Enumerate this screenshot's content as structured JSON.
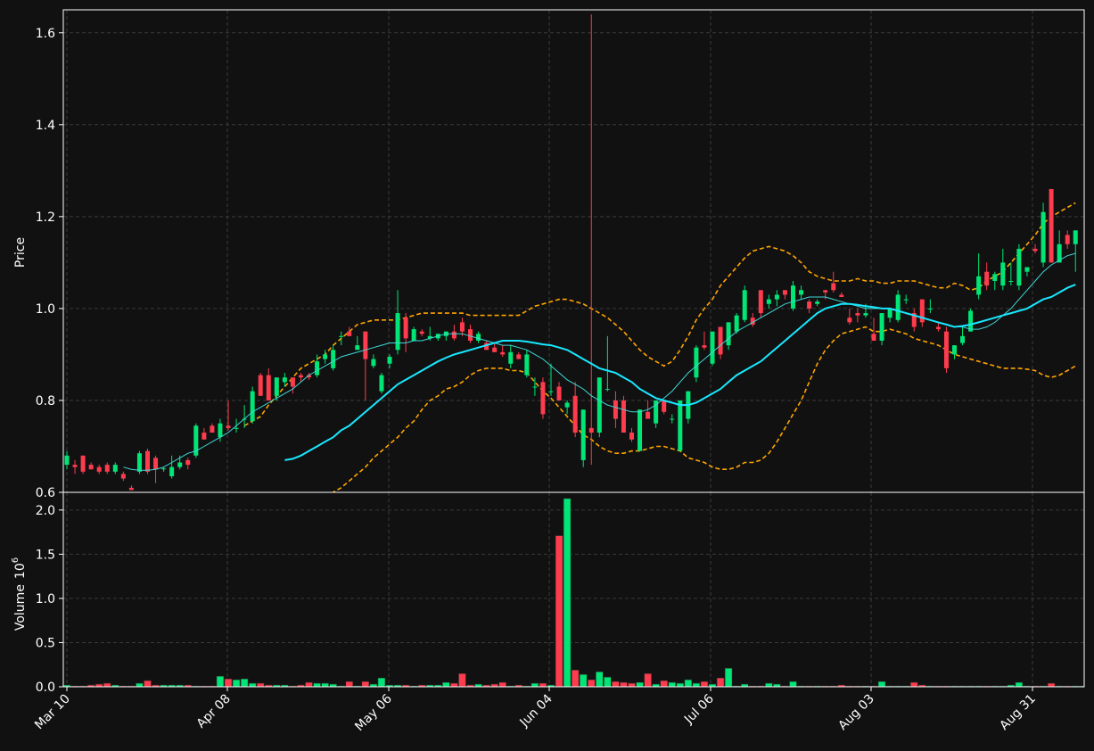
{
  "chart_data": [
    {
      "type": "candlestick",
      "ylabel": "Price",
      "ylim": [
        0.6,
        1.65
      ],
      "yticks": [
        "0.6",
        "0.8",
        "1.0",
        "1.2",
        "1.4",
        "1.6"
      ],
      "xtick_labels": [
        "Mar 10",
        "Apr 08",
        "May 06",
        "Jun 04",
        "Jul 06",
        "Aug 03",
        "Aug 31"
      ],
      "overlays": [
        "moving-average-fast",
        "moving-average-slow",
        "bollinger-upper",
        "bollinger-lower"
      ],
      "grid": true,
      "colors": {
        "up": "#00e676",
        "down": "#ff3b4e",
        "ma_fast": "#40d8d8",
        "ma_slow": "#18e8ff",
        "bands": "#ffa500",
        "background": "#111111",
        "grid": "#3a3a3a",
        "text": "#ffffff"
      },
      "ohlc": [
        [
          0.66,
          0.69,
          0.65,
          0.68
        ],
        [
          0.66,
          0.67,
          0.64,
          0.655
        ],
        [
          0.68,
          0.68,
          0.64,
          0.645
        ],
        [
          0.66,
          0.665,
          0.65,
          0.65
        ],
        [
          0.655,
          0.66,
          0.64,
          0.645
        ],
        [
          0.66,
          0.665,
          0.64,
          0.645
        ],
        [
          0.645,
          0.665,
          0.64,
          0.66
        ],
        [
          0.64,
          0.645,
          0.625,
          0.63
        ],
        [
          0.61,
          0.615,
          0.605,
          0.605
        ],
        [
          0.645,
          0.69,
          0.64,
          0.685
        ],
        [
          0.69,
          0.695,
          0.64,
          0.645
        ],
        [
          0.675,
          0.68,
          0.62,
          0.65
        ],
        [
          0.65,
          0.655,
          0.645,
          0.652
        ],
        [
          0.635,
          0.68,
          0.63,
          0.655
        ],
        [
          0.655,
          0.68,
          0.65,
          0.665
        ],
        [
          0.67,
          0.675,
          0.65,
          0.66
        ],
        [
          0.68,
          0.75,
          0.675,
          0.745
        ],
        [
          0.73,
          0.74,
          0.715,
          0.715
        ],
        [
          0.745,
          0.75,
          0.735,
          0.73
        ],
        [
          0.72,
          0.76,
          0.71,
          0.75
        ],
        [
          0.745,
          0.8,
          0.735,
          0.74
        ],
        [
          0.74,
          0.76,
          0.73,
          0.74
        ],
        [
          0.76,
          0.79,
          0.74,
          0.76
        ],
        [
          0.755,
          0.83,
          0.75,
          0.82
        ],
        [
          0.855,
          0.86,
          0.81,
          0.81
        ],
        [
          0.855,
          0.87,
          0.8,
          0.8
        ],
        [
          0.81,
          0.85,
          0.8,
          0.85
        ],
        [
          0.84,
          0.86,
          0.83,
          0.85
        ],
        [
          0.85,
          0.85,
          0.815,
          0.83
        ],
        [
          0.855,
          0.86,
          0.84,
          0.85
        ],
        [
          0.855,
          0.86,
          0.845,
          0.85
        ],
        [
          0.855,
          0.9,
          0.85,
          0.885
        ],
        [
          0.89,
          0.91,
          0.88,
          0.9
        ],
        [
          0.87,
          0.92,
          0.865,
          0.91
        ],
        [
          0.94,
          0.95,
          0.92,
          0.94
        ],
        [
          0.95,
          0.96,
          0.94,
          0.94
        ],
        [
          0.91,
          0.94,
          0.91,
          0.92
        ],
        [
          0.95,
          0.95,
          0.8,
          0.89
        ],
        [
          0.875,
          0.9,
          0.87,
          0.89
        ],
        [
          0.82,
          0.86,
          0.815,
          0.855
        ],
        [
          0.88,
          0.9,
          0.87,
          0.895
        ],
        [
          0.91,
          1.04,
          0.9,
          0.99
        ],
        [
          0.98,
          0.99,
          0.905,
          0.935
        ],
        [
          0.93,
          0.96,
          0.93,
          0.955
        ],
        [
          0.95,
          0.955,
          0.94,
          0.945
        ],
        [
          0.935,
          0.96,
          0.93,
          0.94
        ],
        [
          0.935,
          0.945,
          0.93,
          0.945
        ],
        [
          0.94,
          0.95,
          0.93,
          0.95
        ],
        [
          0.95,
          0.965,
          0.93,
          0.935
        ],
        [
          0.97,
          0.98,
          0.94,
          0.95
        ],
        [
          0.955,
          0.965,
          0.925,
          0.93
        ],
        [
          0.93,
          0.95,
          0.925,
          0.945
        ],
        [
          0.925,
          0.93,
          0.91,
          0.91
        ],
        [
          0.915,
          0.925,
          0.905,
          0.905
        ],
        [
          0.905,
          0.92,
          0.895,
          0.9
        ],
        [
          0.88,
          0.92,
          0.87,
          0.905
        ],
        [
          0.9,
          0.905,
          0.89,
          0.89
        ],
        [
          0.855,
          0.91,
          0.85,
          0.9
        ],
        [
          0.83,
          0.85,
          0.81,
          0.83
        ],
        [
          0.84,
          0.85,
          0.76,
          0.77
        ],
        [
          0.82,
          0.88,
          0.81,
          0.82
        ],
        [
          0.83,
          0.84,
          0.8,
          0.8
        ],
        [
          0.785,
          0.8,
          0.77,
          0.795
        ],
        [
          0.81,
          0.84,
          0.72,
          0.73
        ],
        [
          0.67,
          0.78,
          0.655,
          0.78
        ],
        [
          0.74,
          1.64,
          0.66,
          0.73
        ],
        [
          0.73,
          0.82,
          0.72,
          0.85
        ],
        [
          0.825,
          0.94,
          0.82,
          0.825
        ],
        [
          0.8,
          0.82,
          0.74,
          0.76
        ],
        [
          0.8,
          0.81,
          0.73,
          0.73
        ],
        [
          0.73,
          0.74,
          0.71,
          0.715
        ],
        [
          0.69,
          0.78,
          0.69,
          0.78
        ],
        [
          0.775,
          0.8,
          0.76,
          0.76
        ],
        [
          0.75,
          0.8,
          0.74,
          0.8
        ],
        [
          0.8,
          0.8,
          0.77,
          0.775
        ],
        [
          0.76,
          0.77,
          0.75,
          0.76
        ],
        [
          0.69,
          0.8,
          0.69,
          0.8
        ],
        [
          0.76,
          0.82,
          0.75,
          0.82
        ],
        [
          0.85,
          0.92,
          0.84,
          0.915
        ],
        [
          0.92,
          0.95,
          0.91,
          0.915
        ],
        [
          0.88,
          0.94,
          0.875,
          0.95
        ],
        [
          0.96,
          0.96,
          0.89,
          0.9
        ],
        [
          0.92,
          0.97,
          0.91,
          0.97
        ],
        [
          0.95,
          0.99,
          0.945,
          0.985
        ],
        [
          0.975,
          1.05,
          0.97,
          1.04
        ],
        [
          0.98,
          0.99,
          0.96,
          0.965
        ],
        [
          1.04,
          1.04,
          0.98,
          0.99
        ],
        [
          1.01,
          1.03,
          1.0,
          1.02
        ],
        [
          1.02,
          1.04,
          1.005,
          1.03
        ],
        [
          1.04,
          1.04,
          1.02,
          1.03
        ],
        [
          1.0,
          1.06,
          0.995,
          1.05
        ],
        [
          1.03,
          1.05,
          1.02,
          1.04
        ],
        [
          1.015,
          1.02,
          0.99,
          1.0
        ],
        [
          1.01,
          1.02,
          1.005,
          1.015
        ],
        [
          1.04,
          1.04,
          1.02,
          1.035
        ],
        [
          1.055,
          1.08,
          1.035,
          1.04
        ],
        [
          1.03,
          1.035,
          1.025,
          1.025
        ],
        [
          0.98,
          1.0,
          0.965,
          0.97
        ],
        [
          0.99,
          1.0,
          0.97,
          0.985
        ],
        [
          0.985,
          1.01,
          0.98,
          0.99
        ],
        [
          0.945,
          0.98,
          0.93,
          0.93
        ],
        [
          0.93,
          0.98,
          0.92,
          0.99
        ],
        [
          0.98,
          1.0,
          0.97,
          1.0
        ],
        [
          0.975,
          1.04,
          0.97,
          1.03
        ],
        [
          1.02,
          1.03,
          1.01,
          1.02
        ],
        [
          0.99,
          1.0,
          0.95,
          0.96
        ],
        [
          1.02,
          1.02,
          0.96,
          0.97
        ],
        [
          1.0,
          1.02,
          0.99,
          1.0
        ],
        [
          0.96,
          0.97,
          0.95,
          0.955
        ],
        [
          0.95,
          0.96,
          0.86,
          0.87
        ],
        [
          0.9,
          0.92,
          0.89,
          0.92
        ],
        [
          0.925,
          0.96,
          0.92,
          0.94
        ],
        [
          0.95,
          1.0,
          0.95,
          0.995
        ],
        [
          1.03,
          1.12,
          1.02,
          1.07
        ],
        [
          1.08,
          1.1,
          1.04,
          1.05
        ],
        [
          1.06,
          1.08,
          1.04,
          1.075
        ],
        [
          1.05,
          1.13,
          1.04,
          1.1
        ],
        [
          1.06,
          1.1,
          1.05,
          1.06
        ],
        [
          1.05,
          1.14,
          1.04,
          1.13
        ],
        [
          1.08,
          1.09,
          1.07,
          1.09
        ],
        [
          1.13,
          1.14,
          1.12,
          1.125
        ],
        [
          1.1,
          1.23,
          1.09,
          1.21
        ],
        [
          1.26,
          1.26,
          1.1,
          1.1
        ],
        [
          1.1,
          1.17,
          1.1,
          1.14
        ],
        [
          1.16,
          1.17,
          1.13,
          1.14
        ],
        [
          1.14,
          1.17,
          1.08,
          1.17
        ]
      ],
      "ma_fast": [
        0.655,
        0.65,
        0.648,
        0.648,
        0.65,
        0.655,
        0.665,
        0.675,
        0.685,
        0.69,
        0.7,
        0.71,
        0.72,
        0.73,
        0.745,
        0.76,
        0.775,
        0.785,
        0.795,
        0.805,
        0.815,
        0.825,
        0.84,
        0.855,
        0.865,
        0.875,
        0.885,
        0.895,
        0.9,
        0.905,
        0.91,
        0.915,
        0.92,
        0.925,
        0.925,
        0.925,
        0.93,
        0.93,
        0.935,
        0.94,
        0.945,
        0.945,
        0.945,
        0.94,
        0.935,
        0.93,
        0.925,
        0.92,
        0.92,
        0.915,
        0.91,
        0.9,
        0.89,
        0.875,
        0.86,
        0.845,
        0.835,
        0.825,
        0.81,
        0.8,
        0.79,
        0.785,
        0.78,
        0.775,
        0.775,
        0.78,
        0.79,
        0.805,
        0.82,
        0.84,
        0.86,
        0.875,
        0.89,
        0.905,
        0.92,
        0.935,
        0.95,
        0.96,
        0.97,
        0.98,
        0.99,
        1.0,
        1.01,
        1.015,
        1.02,
        1.025,
        1.025,
        1.025,
        1.02,
        1.015,
        1.01,
        1.005,
        1.0,
        1.0,
        1.0,
        1.0,
        0.995,
        0.99,
        0.985,
        0.98,
        0.975,
        0.97,
        0.965,
        0.96,
        0.96,
        0.955,
        0.955,
        0.96,
        0.97,
        0.985,
        1.0,
        1.02,
        1.04,
        1.06,
        1.08,
        1.095,
        1.105,
        1.115,
        1.12
      ],
      "ma_slow": [
        0.67,
        0.673,
        0.68,
        0.69,
        0.7,
        0.71,
        0.72,
        0.735,
        0.745,
        0.76,
        0.775,
        0.79,
        0.805,
        0.82,
        0.835,
        0.845,
        0.855,
        0.865,
        0.875,
        0.885,
        0.893,
        0.9,
        0.905,
        0.91,
        0.915,
        0.92,
        0.925,
        0.93,
        0.93,
        0.93,
        0.928,
        0.925,
        0.922,
        0.92,
        0.915,
        0.91,
        0.9,
        0.89,
        0.88,
        0.87,
        0.865,
        0.86,
        0.85,
        0.84,
        0.825,
        0.815,
        0.805,
        0.8,
        0.795,
        0.79,
        0.79,
        0.795,
        0.805,
        0.815,
        0.825,
        0.84,
        0.855,
        0.865,
        0.875,
        0.885,
        0.9,
        0.915,
        0.93,
        0.945,
        0.96,
        0.975,
        0.99,
        1.0,
        1.005,
        1.01,
        1.01,
        1.008,
        1.005,
        1.003,
        1.0,
        1.0,
        0.995,
        0.99,
        0.985,
        0.98,
        0.975,
        0.97,
        0.965,
        0.96,
        0.962,
        0.965,
        0.97,
        0.975,
        0.98,
        0.985,
        0.99,
        0.995,
        1.0,
        1.01,
        1.02,
        1.025,
        1.035,
        1.045,
        1.052
      ],
      "band_upper": [
        0.745,
        0.755,
        0.765,
        0.79,
        0.81,
        0.83,
        0.85,
        0.87,
        0.88,
        0.89,
        0.9,
        0.92,
        0.935,
        0.95,
        0.965,
        0.97,
        0.975,
        0.975,
        0.975,
        0.975,
        0.98,
        0.985,
        0.99,
        0.99,
        0.99,
        0.99,
        0.99,
        0.99,
        0.985,
        0.985,
        0.985,
        0.985,
        0.985,
        0.985,
        0.985,
        0.995,
        1.005,
        1.01,
        1.015,
        1.02,
        1.02,
        1.015,
        1.01,
        1.0,
        0.99,
        0.98,
        0.965,
        0.95,
        0.93,
        0.91,
        0.895,
        0.885,
        0.875,
        0.885,
        0.91,
        0.94,
        0.975,
        1.0,
        1.02,
        1.05,
        1.07,
        1.09,
        1.11,
        1.125,
        1.13,
        1.135,
        1.13,
        1.125,
        1.115,
        1.1,
        1.08,
        1.07,
        1.065,
        1.06,
        1.06,
        1.06,
        1.065,
        1.06,
        1.06,
        1.055,
        1.055,
        1.06,
        1.06,
        1.06,
        1.055,
        1.05,
        1.045,
        1.045,
        1.055,
        1.05,
        1.04,
        1.045,
        1.06,
        1.07,
        1.08,
        1.1,
        1.12,
        1.14,
        1.16,
        1.185,
        1.2,
        1.21,
        1.22,
        1.23
      ],
      "band_lower": [
        0.59,
        0.6,
        0.61,
        0.625,
        0.64,
        0.655,
        0.675,
        0.69,
        0.705,
        0.72,
        0.74,
        0.755,
        0.78,
        0.8,
        0.81,
        0.825,
        0.83,
        0.84,
        0.855,
        0.865,
        0.87,
        0.87,
        0.87,
        0.865,
        0.865,
        0.86,
        0.84,
        0.82,
        0.805,
        0.785,
        0.765,
        0.745,
        0.725,
        0.715,
        0.7,
        0.69,
        0.685,
        0.685,
        0.69,
        0.69,
        0.695,
        0.7,
        0.7,
        0.695,
        0.69,
        0.675,
        0.67,
        0.665,
        0.655,
        0.65,
        0.65,
        0.655,
        0.665,
        0.665,
        0.67,
        0.685,
        0.71,
        0.74,
        0.77,
        0.8,
        0.84,
        0.88,
        0.91,
        0.93,
        0.945,
        0.95,
        0.955,
        0.96,
        0.95,
        0.95,
        0.955,
        0.95,
        0.945,
        0.935,
        0.93,
        0.925,
        0.92,
        0.91,
        0.9,
        0.895,
        0.89,
        0.885,
        0.88,
        0.875,
        0.87,
        0.87,
        0.87,
        0.868,
        0.865,
        0.855,
        0.85,
        0.855,
        0.865,
        0.875
      ]
    },
    {
      "type": "bar",
      "ylabel": "Volume",
      "ylabel_multiplier": "10",
      "ylabel_exponent": "6",
      "ylim": [
        0,
        2.2
      ],
      "yticks": [
        "0.0",
        "0.5",
        "1.0",
        "1.5",
        "2.0"
      ],
      "grid": true,
      "values": [
        0.02,
        0.01,
        0.01,
        0.02,
        0.03,
        0.04,
        0.02,
        0.01,
        0.01,
        0.04,
        0.07,
        0.02,
        0.02,
        0.02,
        0.02,
        0.02,
        0.01,
        0.01,
        0.01,
        0.12,
        0.09,
        0.08,
        0.09,
        0.04,
        0.04,
        0.02,
        0.02,
        0.02,
        0.01,
        0.02,
        0.05,
        0.04,
        0.04,
        0.03,
        0.01,
        0.06,
        0.01,
        0.06,
        0.03,
        0.1,
        0.02,
        0.02,
        0.02,
        0.01,
        0.02,
        0.02,
        0.02,
        0.05,
        0.04,
        0.15,
        0.02,
        0.03,
        0.02,
        0.03,
        0.05,
        0.01,
        0.02,
        0.01,
        0.04,
        0.04,
        0.02,
        1.71,
        2.13,
        0.19,
        0.14,
        0.08,
        0.17,
        0.11,
        0.06,
        0.05,
        0.04,
        0.05,
        0.15,
        0.03,
        0.07,
        0.05,
        0.04,
        0.08,
        0.04,
        0.06,
        0.03,
        0.1,
        0.21,
        0.01,
        0.03,
        0.01,
        0.01,
        0.04,
        0.03,
        0.01,
        0.06,
        0.01,
        0.01,
        0.01,
        0.01,
        0.01,
        0.02,
        0.01,
        0.01,
        0.01,
        0.01,
        0.06,
        0.01,
        0.01,
        0.01,
        0.05,
        0.02,
        0.01,
        0.01,
        0.01,
        0.01,
        0.01,
        0.01,
        0.01,
        0.01,
        0.01,
        0.01,
        0.02,
        0.05,
        0.01,
        0.01,
        0.01,
        0.04,
        0.01,
        0.01,
        0.01,
        0.01,
        0.02,
        0.02,
        0.01
      ]
    }
  ]
}
